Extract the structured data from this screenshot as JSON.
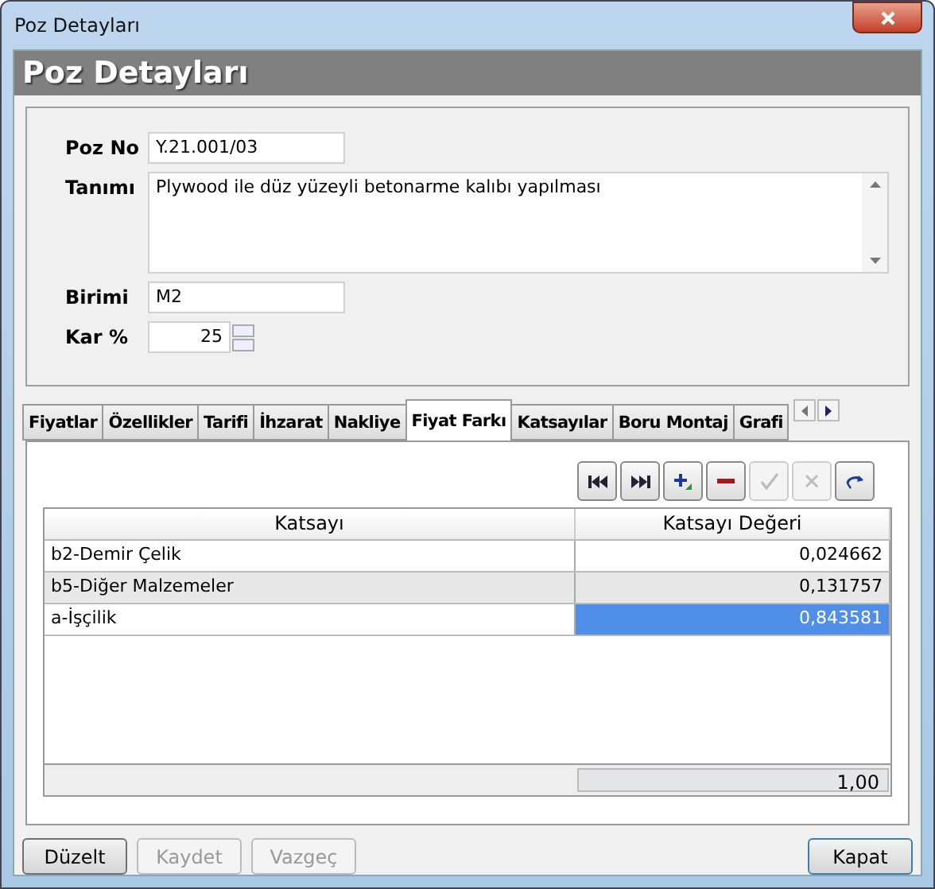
{
  "window": {
    "title": "Poz Detayları"
  },
  "header": "Poz Detayları",
  "form": {
    "poz_no": {
      "label": "Poz No",
      "value": "Y.21.001/03"
    },
    "tanimi": {
      "label": "Tanımı",
      "value": "Plywood ile düz yüzeyli betonarme kalıbı yapılması"
    },
    "birimi": {
      "label": "Birimi",
      "value": "M2"
    },
    "kar": {
      "label": "Kar %",
      "value": "25"
    }
  },
  "tabs": [
    {
      "label": "Fiyatlar",
      "selected": false
    },
    {
      "label": "Özellikler",
      "selected": false
    },
    {
      "label": "Tarifi",
      "selected": false
    },
    {
      "label": "İhzarat",
      "selected": false
    },
    {
      "label": "Nakliye",
      "selected": false
    },
    {
      "label": "Fiyat Farkı",
      "selected": true
    },
    {
      "label": "Katsayılar",
      "selected": false
    },
    {
      "label": "Boru Montaj",
      "selected": false
    },
    {
      "label": "Grafi",
      "selected": false
    }
  ],
  "toolbar": [
    {
      "kind": "first",
      "disabled": false
    },
    {
      "kind": "last",
      "disabled": false
    },
    {
      "kind": "add",
      "disabled": false
    },
    {
      "kind": "remove",
      "disabled": false
    },
    {
      "kind": "confirm",
      "disabled": true
    },
    {
      "kind": "cancel",
      "disabled": true
    },
    {
      "kind": "refresh",
      "disabled": false
    }
  ],
  "table": {
    "columns": [
      "Katsayı",
      "Katsayı Değeri"
    ],
    "rows": [
      {
        "name": "b2-Demir Çelik",
        "value": "0,024662",
        "selected": false
      },
      {
        "name": "b5-Diğer Malzemeler",
        "value": "0,131757",
        "selected": false
      },
      {
        "name": "a-İşçilik",
        "value": "0,843581",
        "selected": true
      }
    ],
    "total": "1,00"
  },
  "left_buttons": [
    {
      "label": "Düzelt",
      "disabled": false
    },
    {
      "label": "Kaydet",
      "disabled": true
    },
    {
      "label": "Vazgeç",
      "disabled": true
    }
  ],
  "right_buttons": [
    {
      "label": "Kapat",
      "disabled": false
    }
  ]
}
